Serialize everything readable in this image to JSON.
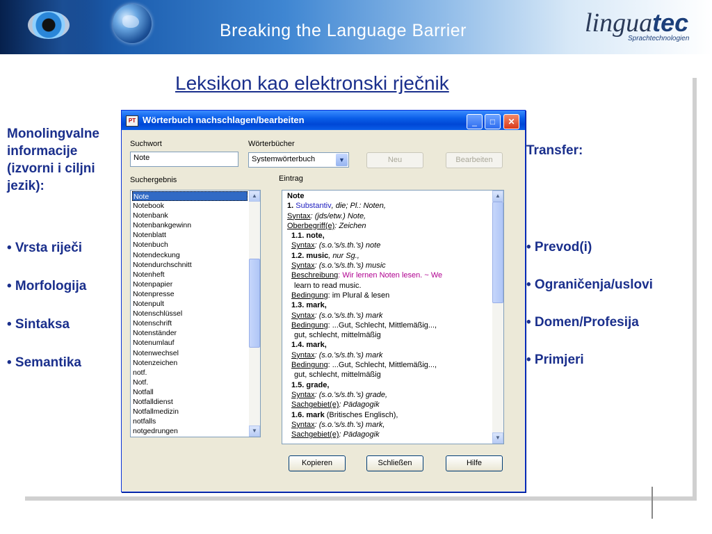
{
  "banner": {
    "tagline": "Breaking the Language Barrier",
    "logo_main": "lingua",
    "logo_bold": "tec",
    "logo_sub": "Sprachtechnologien"
  },
  "slide": {
    "title": "Leksikon kao  elektronski rječnik",
    "left_heading": "Monolingvalne informacije (izvorni i ciljni jezik):",
    "left_bullets": [
      "• Vrsta riječi",
      "• Morfologija",
      "• Sintaksa",
      "• Semantika"
    ],
    "right_heading": "Transfer:",
    "right_bullets": [
      "• Prevod(i)",
      "• Ograničenja/uslovi",
      "• Domen/Profesija",
      "• Primjeri"
    ]
  },
  "dialog": {
    "title": "Wörterbuch nachschlagen/bearbeiten",
    "icon_label": "PT",
    "min_glyph": "_",
    "max_glyph": "□",
    "close_glyph": "✕",
    "suchwort_label": "Suchwort",
    "suchwort_value": "Note",
    "woerterbuecher_label": "Wörterbücher",
    "woerterbuch_value": "Systemwörterbuch",
    "neu_label": "Neu",
    "bearbeiten_label": "Bearbeiten",
    "suchergebnis_label": "Suchergebnis",
    "eintrag_label": "Eintrag",
    "results": [
      "Note",
      "Notebook",
      "Notenbank",
      "Notenbankgewinn",
      "Notenblatt",
      "Notenbuch",
      "Notendeckung",
      "Notendurchschnitt",
      "Notenheft",
      "Notenpapier",
      "Notenpresse",
      "Notenpult",
      "Notenschlüssel",
      "Notenschrift",
      "Notenständer",
      "Notenumlauf",
      "Notenwechsel",
      "Notenzeichen",
      "notf.",
      "Notf.",
      "Notfall",
      "Notfalldienst",
      "Notfallmedizin",
      "notfalls",
      "notgedrungen"
    ],
    "selected_index": 0,
    "entry": {
      "l0": "Note",
      "l1a": "1. ",
      "l1b": "Substantiv",
      "l1c": ", die; Pl.: Noten,",
      "l2a": "Syntax",
      "l2b": ": (jds/etw.) Note,",
      "l3a": "Oberbegriff(e)",
      "l3b": ": Zeichen",
      "l4": "1.1. note,",
      "l5a": "Syntax",
      "l5b": ": (s.o.'s/s.th.'s) note",
      "l6a": "1.2. music",
      "l6b": ", nur Sg.,",
      "l7a": "Syntax",
      "l7b": ": (s.o.'s/s.th.'s) music",
      "l8a": "Beschreibung",
      "l8b": ": Wir lernen Noten lesen. ~ We",
      "l9": "learn to read music.",
      "l10a": "Bedingung",
      "l10b": ": im Plural & lesen",
      "l11": "1.3. mark,",
      "l12a": "Syntax",
      "l12b": ": (s.o.'s/s.th.'s) mark",
      "l13a": "Bedingung",
      "l13b": ": ...Gut, Schlecht, Mittlemäßig...,",
      "l14": "gut, schlecht, mittelmäßig",
      "l15": "1.4. mark,",
      "l16a": "Syntax",
      "l16b": ": (s.o.'s/s.th.'s) mark",
      "l17a": "Bedingung",
      "l17b": ": ...Gut, Schlecht, Mittlemäßig...,",
      "l18": "gut, schlecht, mittelmäßig",
      "l19": "1.5. grade,",
      "l20a": "Syntax",
      "l20b": ": (s.o.'s/s.th.'s) grade,",
      "l21a": "Sachgebiet(e)",
      "l21b": ": Pädagogik",
      "l22a": "1.6. mark",
      "l22b": " (Britisches Englisch),",
      "l23a": "Syntax",
      "l23b": ": (s.o.'s/s.th.'s) mark,",
      "l24a": "Sachgebiet(e)",
      "l24b": ": Pädagogik"
    },
    "kopieren_label": "Kopieren",
    "schliessen_label": "Schließen",
    "hilfe_label": "Hilfe"
  },
  "colors": {
    "slide_text": "#1a2f8c",
    "xp_title": "#0a5ee8",
    "selection": "#316ac5",
    "entry_blue": "#2020c0",
    "entry_magenta": "#b00090"
  }
}
